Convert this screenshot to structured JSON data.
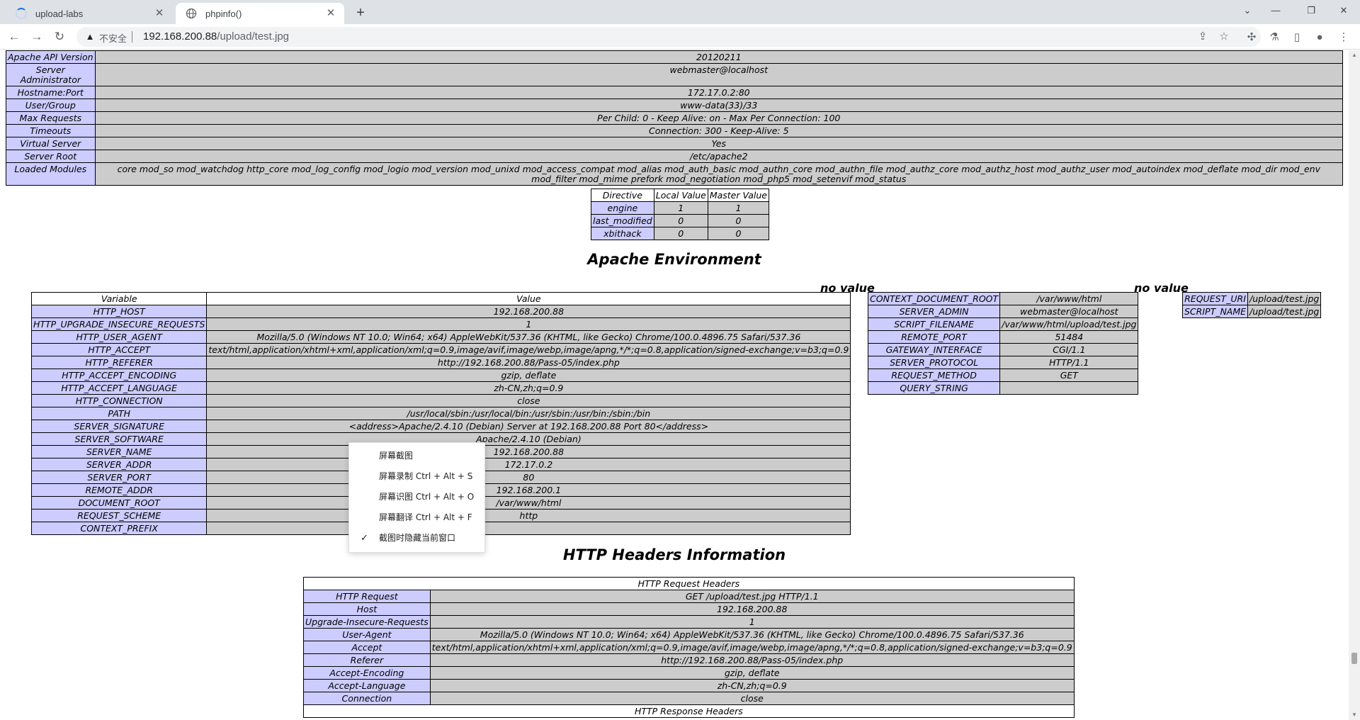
{
  "browser": {
    "tabs": [
      {
        "title": "upload-labs",
        "active": false,
        "loading": true
      },
      {
        "title": "phpinfo()",
        "active": true,
        "loading": false
      }
    ],
    "new_tab_label": "+",
    "security_label": "不安全",
    "url_host": "192.168.200.88",
    "url_path": "/upload/test.jpg"
  },
  "apache_config": [
    {
      "name": "Apache API Version",
      "value": "20120211"
    },
    {
      "name": "Server Administrator",
      "value": "webmaster@localhost"
    },
    {
      "name": "Hostname:Port",
      "value": "172.17.0.2:80"
    },
    {
      "name": "User/Group",
      "value": "www-data(33)/33"
    },
    {
      "name": "Max Requests",
      "value": "Per Child: 0 - Keep Alive: on - Max Per Connection: 100"
    },
    {
      "name": "Timeouts",
      "value": "Connection: 300 - Keep-Alive: 5"
    },
    {
      "name": "Virtual Server",
      "value": "Yes"
    },
    {
      "name": "Server Root",
      "value": "/etc/apache2"
    },
    {
      "name": "Loaded Modules",
      "value": "core mod_so mod_watchdog http_core mod_log_config mod_logio mod_version mod_unixd mod_access_compat mod_alias mod_auth_basic mod_authn_core mod_authn_file mod_authz_core mod_authz_host mod_authz_user mod_autoindex mod_deflate mod_dir mod_env mod_filter mod_mime prefork mod_negotiation mod_php5 mod_setenvif mod_status"
    }
  ],
  "directives": {
    "headers": [
      "Directive",
      "Local Value",
      "Master Value"
    ],
    "rows": [
      {
        "name": "engine",
        "local": "1",
        "master": "1"
      },
      {
        "name": "last_modified",
        "local": "0",
        "master": "0"
      },
      {
        "name": "xbithack",
        "local": "0",
        "master": "0"
      }
    ]
  },
  "apache_env": {
    "heading": "Apache Environment",
    "no_value_1": "no value",
    "no_value_2": "no value",
    "headers": [
      "Variable",
      "Value"
    ],
    "rows": [
      {
        "name": "HTTP_HOST",
        "value": "192.168.200.88"
      },
      {
        "name": "HTTP_UPGRADE_INSECURE_REQUESTS",
        "value": "1"
      },
      {
        "name": "HTTP_USER_AGENT",
        "value": "Mozilla/5.0 (Windows NT 10.0; Win64; x64) AppleWebKit/537.36 (KHTML, like Gecko) Chrome/100.0.4896.75 Safari/537.36"
      },
      {
        "name": "HTTP_ACCEPT",
        "value": "text/html,application/xhtml+xml,application/xml;q=0.9,image/avif,image/webp,image/apng,*/*;q=0.8,application/signed-exchange;v=b3;q=0.9"
      },
      {
        "name": "HTTP_REFERER",
        "value": "http://192.168.200.88/Pass-05/index.php"
      },
      {
        "name": "HTTP_ACCEPT_ENCODING",
        "value": "gzip, deflate"
      },
      {
        "name": "HTTP_ACCEPT_LANGUAGE",
        "value": "zh-CN,zh;q=0.9"
      },
      {
        "name": "HTTP_CONNECTION",
        "value": "close"
      },
      {
        "name": "PATH",
        "value": "/usr/local/sbin:/usr/local/bin:/usr/sbin:/usr/bin:/sbin:/bin"
      },
      {
        "name": "SERVER_SIGNATURE",
        "value": "<address>Apache/2.4.10 (Debian) Server at 192.168.200.88 Port 80</address>"
      },
      {
        "name": "SERVER_SOFTWARE",
        "value": "Apache/2.4.10 (Debian)"
      },
      {
        "name": "SERVER_NAME",
        "value": "192.168.200.88"
      },
      {
        "name": "SERVER_ADDR",
        "value": "172.17.0.2"
      },
      {
        "name": "SERVER_PORT",
        "value": "80"
      },
      {
        "name": "REMOTE_ADDR",
        "value": "192.168.200.1"
      },
      {
        "name": "DOCUMENT_ROOT",
        "value": "/var/www/html"
      },
      {
        "name": "REQUEST_SCHEME",
        "value": "http"
      },
      {
        "name": "CONTEXT_PREFIX",
        "value": ""
      }
    ],
    "rows_2": [
      {
        "name": "CONTEXT_DOCUMENT_ROOT",
        "value": "/var/www/html"
      },
      {
        "name": "SERVER_ADMIN",
        "value": "webmaster@localhost"
      },
      {
        "name": "SCRIPT_FILENAME",
        "value": "/var/www/html/upload/test.jpg"
      },
      {
        "name": "REMOTE_PORT",
        "value": "51484"
      },
      {
        "name": "GATEWAY_INTERFACE",
        "value": "CGI/1.1"
      },
      {
        "name": "SERVER_PROTOCOL",
        "value": "HTTP/1.1"
      },
      {
        "name": "REQUEST_METHOD",
        "value": "GET"
      },
      {
        "name": "QUERY_STRING",
        "value": ""
      }
    ],
    "rows_3": [
      {
        "name": "REQUEST_URI",
        "value": "/upload/test.jpg"
      },
      {
        "name": "SCRIPT_NAME",
        "value": "/upload/test.jpg"
      }
    ]
  },
  "http_headers": {
    "heading": "HTTP Headers Information",
    "request_title": "HTTP Request Headers",
    "response_title": "HTTP Response Headers",
    "rows": [
      {
        "name": "HTTP Request",
        "value": "GET /upload/test.jpg HTTP/1.1"
      },
      {
        "name": "Host",
        "value": "192.168.200.88"
      },
      {
        "name": "Upgrade-Insecure-Requests",
        "value": "1"
      },
      {
        "name": "User-Agent",
        "value": "Mozilla/5.0 (Windows NT 10.0; Win64; x64) AppleWebKit/537.36 (KHTML, like Gecko) Chrome/100.0.4896.75 Safari/537.36"
      },
      {
        "name": "Accept",
        "value": "text/html,application/xhtml+xml,application/xml;q=0.9,image/avif,image/webp,image/apng,*/*;q=0.8,application/signed-exchange;v=b3;q=0.9"
      },
      {
        "name": "Referer",
        "value": "http://192.168.200.88/Pass-05/index.php"
      },
      {
        "name": "Accept-Encoding",
        "value": "gzip, deflate"
      },
      {
        "name": "Accept-Language",
        "value": "zh-CN,zh;q=0.9"
      },
      {
        "name": "Connection",
        "value": "close"
      }
    ]
  },
  "context_menu": {
    "items": [
      {
        "label": "屏幕截图",
        "checked": false
      },
      {
        "label": "屏幕录制 Ctrl + Alt + S",
        "checked": false
      },
      {
        "label": "屏幕识图 Ctrl + Alt + O",
        "checked": false
      },
      {
        "label": "屏幕翻译 Ctrl + Alt + F",
        "checked": false
      },
      {
        "label": "截图时隐藏当前窗口",
        "checked": true
      }
    ]
  }
}
